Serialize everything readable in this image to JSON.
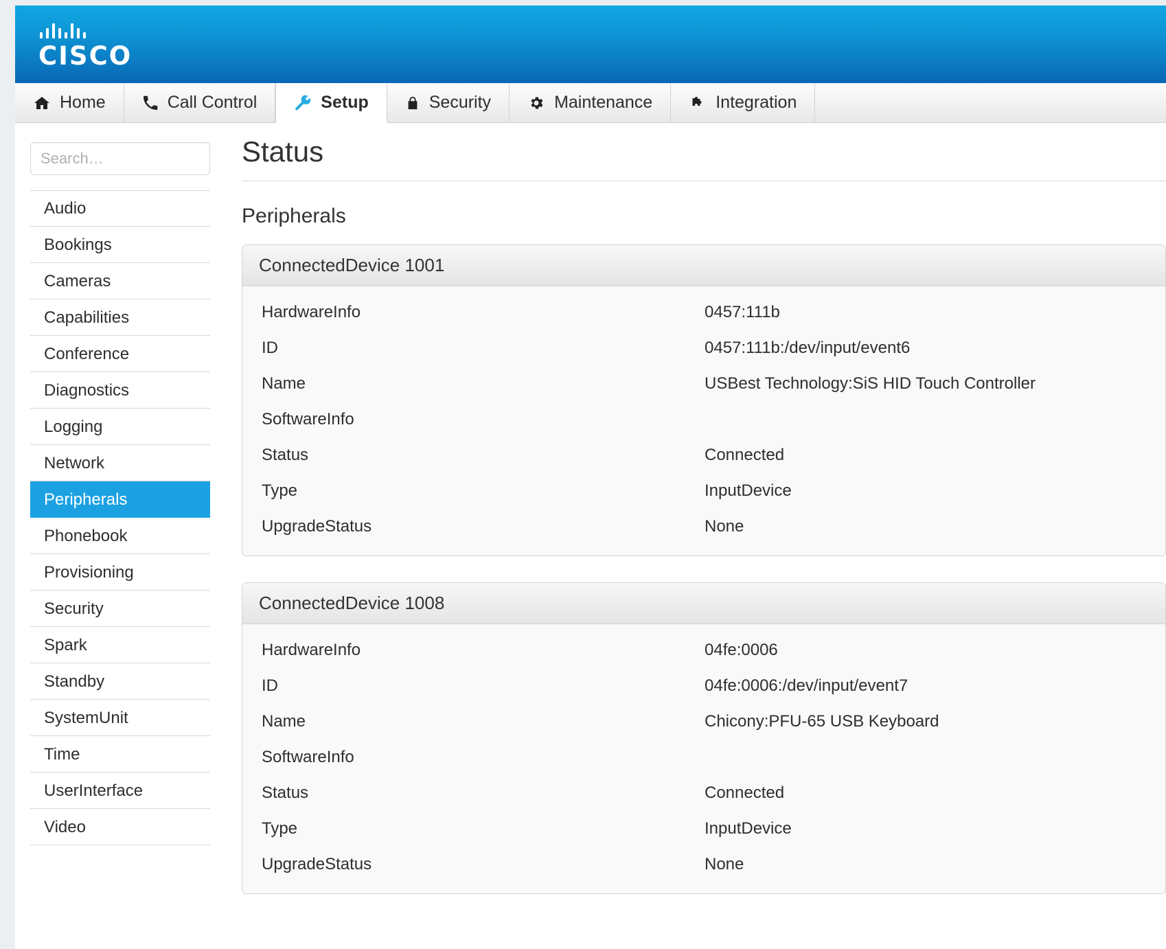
{
  "brand": {
    "name": "CISCO",
    "logo_icon": "cisco-logo"
  },
  "nav": {
    "tabs": [
      {
        "label": "Home",
        "icon": "home-icon",
        "active": false
      },
      {
        "label": "Call Control",
        "icon": "phone-icon",
        "active": false
      },
      {
        "label": "Setup",
        "icon": "wrench-icon",
        "active": true
      },
      {
        "label": "Security",
        "icon": "lock-icon",
        "active": false
      },
      {
        "label": "Maintenance",
        "icon": "gear-icon",
        "active": false
      },
      {
        "label": "Integration",
        "icon": "puzzle-icon",
        "active": false
      }
    ]
  },
  "sidebar": {
    "search": {
      "value": "",
      "placeholder": "Search…"
    },
    "items": [
      {
        "label": "Audio",
        "selected": false
      },
      {
        "label": "Bookings",
        "selected": false
      },
      {
        "label": "Cameras",
        "selected": false
      },
      {
        "label": "Capabilities",
        "selected": false
      },
      {
        "label": "Conference",
        "selected": false
      },
      {
        "label": "Diagnostics",
        "selected": false
      },
      {
        "label": "Logging",
        "selected": false
      },
      {
        "label": "Network",
        "selected": false
      },
      {
        "label": "Peripherals",
        "selected": true
      },
      {
        "label": "Phonebook",
        "selected": false
      },
      {
        "label": "Provisioning",
        "selected": false
      },
      {
        "label": "Security",
        "selected": false
      },
      {
        "label": "Spark",
        "selected": false
      },
      {
        "label": "Standby",
        "selected": false
      },
      {
        "label": "SystemUnit",
        "selected": false
      },
      {
        "label": "Time",
        "selected": false
      },
      {
        "label": "UserInterface",
        "selected": false
      },
      {
        "label": "Video",
        "selected": false
      }
    ]
  },
  "main": {
    "page_title": "Status",
    "section_title": "Peripherals",
    "panels": [
      {
        "title": "ConnectedDevice 1001",
        "rows": [
          {
            "label": "HardwareInfo",
            "value": "0457:111b"
          },
          {
            "label": "ID",
            "value": "0457:111b:/dev/input/event6"
          },
          {
            "label": "Name",
            "value": "USBest Technology:SiS HID Touch Controller"
          },
          {
            "label": "SoftwareInfo",
            "value": ""
          },
          {
            "label": "Status",
            "value": "Connected"
          },
          {
            "label": "Type",
            "value": "InputDevice"
          },
          {
            "label": "UpgradeStatus",
            "value": "None"
          }
        ]
      },
      {
        "title": "ConnectedDevice 1008",
        "rows": [
          {
            "label": "HardwareInfo",
            "value": "04fe:0006"
          },
          {
            "label": "ID",
            "value": "04fe:0006:/dev/input/event7"
          },
          {
            "label": "Name",
            "value": "Chicony:PFU-65 USB Keyboard"
          },
          {
            "label": "SoftwareInfo",
            "value": ""
          },
          {
            "label": "Status",
            "value": "Connected"
          },
          {
            "label": "Type",
            "value": "InputDevice"
          },
          {
            "label": "UpgradeStatus",
            "value": "None"
          }
        ]
      }
    ]
  },
  "colors": {
    "brand_blue_top": "#11a6e2",
    "brand_blue_bottom": "#0967b4",
    "selected_blue": "#1ba1e2",
    "active_icon_blue": "#29abe2"
  }
}
